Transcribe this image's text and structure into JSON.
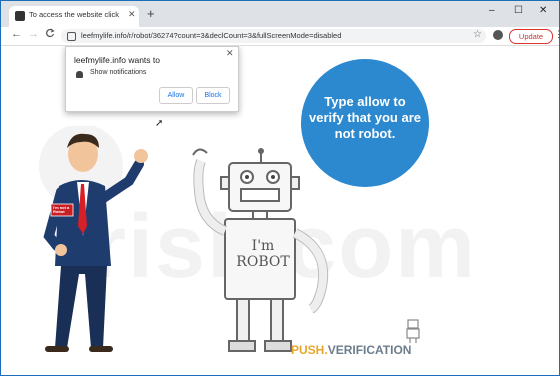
{
  "tab": {
    "title": "To access the website click the \"A"
  },
  "window_controls": {
    "min": "–",
    "max": "☐",
    "close": "✕"
  },
  "toolbar": {
    "back": "←",
    "forward": "→",
    "reload": "C",
    "url": "leefmylife.info/r/robot/36274?count=3&declCount=3&fullScreenMode=disabled",
    "update_label": "Update",
    "menu": "⋮"
  },
  "popup": {
    "title": "leefmylife.info wants to",
    "subtitle": "Show notifications",
    "allow": "Allow",
    "block": "Block",
    "close": "✕"
  },
  "main": {
    "message": "Type allow to verify that you are not robot.",
    "watermark": "risk.com",
    "robot_text": "I'm ROBOT",
    "badge_text": "I'm not a Robot",
    "brand_part1": "PUSH.",
    "brand_part2": "VERIFICATION"
  },
  "colors": {
    "accent": "#2c88cf",
    "brand_orange": "#e8a72c",
    "update": "#cc3333"
  }
}
